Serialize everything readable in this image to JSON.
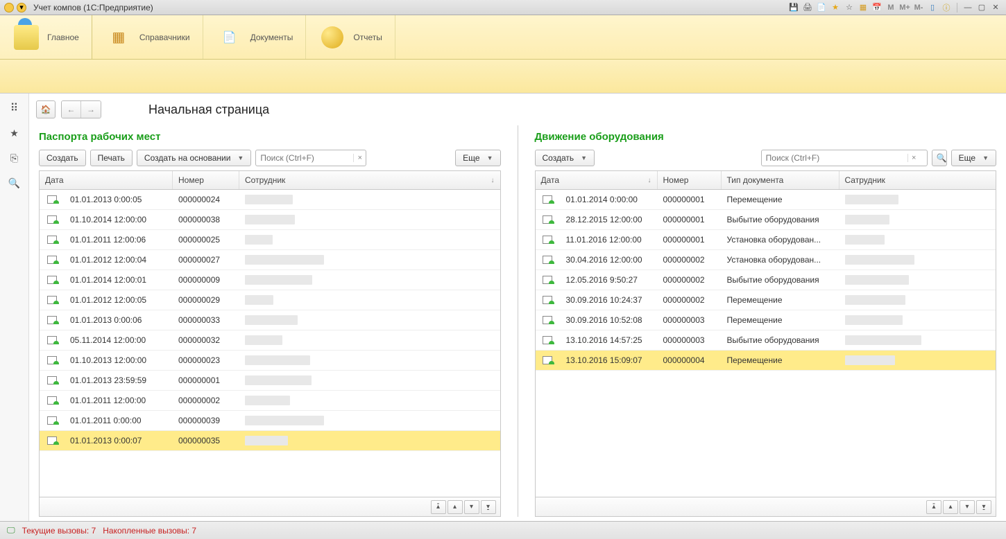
{
  "window": {
    "title": "Учет компов  (1С:Предприятие)"
  },
  "mainTabs": {
    "items": [
      {
        "label": "Главное"
      },
      {
        "label": "Справачники"
      },
      {
        "label": "Документы"
      },
      {
        "label": "Отчеты"
      }
    ]
  },
  "page": {
    "title": "Начальная страница"
  },
  "pane1": {
    "header": "Паспорта рабочих мест",
    "create": "Создать",
    "print": "Печать",
    "createFrom": "Создать на основании",
    "searchPlaceholder": "Поиск (Ctrl+F)",
    "more": "Еще",
    "cols": {
      "date": "Дата",
      "number": "Номер",
      "employee": "Сотрудник"
    },
    "rows": [
      {
        "date": "01.01.2013 0:00:05",
        "num": "000000024"
      },
      {
        "date": "01.10.2014 12:00:00",
        "num": "000000038"
      },
      {
        "date": "01.01.2011 12:00:06",
        "num": "000000025"
      },
      {
        "date": "01.01.2012 12:00:04",
        "num": "000000027"
      },
      {
        "date": "01.01.2014 12:00:01",
        "num": "000000009"
      },
      {
        "date": "01.01.2012 12:00:05",
        "num": "000000029"
      },
      {
        "date": "01.01.2013 0:00:06",
        "num": "000000033"
      },
      {
        "date": "05.11.2014 12:00:00",
        "num": "000000032"
      },
      {
        "date": "01.10.2013 12:00:00",
        "num": "000000023"
      },
      {
        "date": "01.01.2013 23:59:59",
        "num": "000000001"
      },
      {
        "date": "01.01.2011 12:00:00",
        "num": "000000002"
      },
      {
        "date": "01.01.2011 0:00:00",
        "num": "000000039"
      },
      {
        "date": "01.01.2013 0:00:07",
        "num": "000000035"
      }
    ]
  },
  "pane2": {
    "header": "Движение оборудования",
    "create": "Создать",
    "searchPlaceholder": "Поиск (Ctrl+F)",
    "more": "Еще",
    "cols": {
      "date": "Дата",
      "number": "Номер",
      "type": "Тип документа",
      "employee": "Сатрудник"
    },
    "rows": [
      {
        "date": "01.01.2014 0:00:00",
        "num": "000000001",
        "type": "Перемещение"
      },
      {
        "date": "28.12.2015 12:00:00",
        "num": "000000001",
        "type": "Выбытие оборудования"
      },
      {
        "date": "11.01.2016 12:00:00",
        "num": "000000001",
        "type": "Установка оборудован..."
      },
      {
        "date": "30.04.2016 12:00:00",
        "num": "000000002",
        "type": "Установка оборудован..."
      },
      {
        "date": "12.05.2016 9:50:27",
        "num": "000000002",
        "type": "Выбытие оборудования"
      },
      {
        "date": "30.09.2016 10:24:37",
        "num": "000000002",
        "type": "Перемещение"
      },
      {
        "date": "30.09.2016 10:52:08",
        "num": "000000003",
        "type": "Перемещение"
      },
      {
        "date": "13.10.2016 14:57:25",
        "num": "000000003",
        "type": "Выбытие оборудования"
      },
      {
        "date": "13.10.2016 15:09:07",
        "num": "000000004",
        "type": "Перемещение"
      }
    ]
  },
  "status": {
    "current": "Текущие вызовы: 7",
    "acc": "Накопленные вызовы: 7"
  }
}
